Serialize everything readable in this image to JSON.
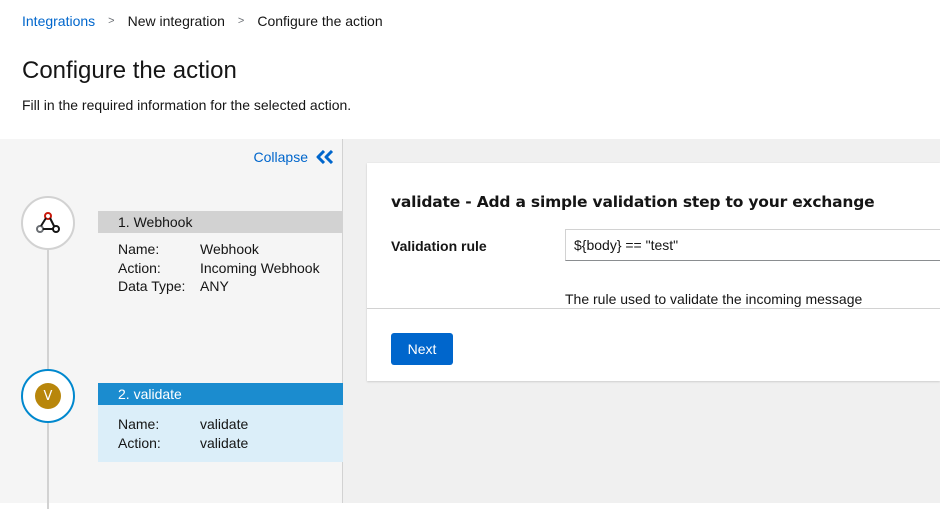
{
  "breadcrumb": {
    "items": [
      "Integrations",
      "New integration",
      "Configure the action"
    ],
    "separator": ">"
  },
  "page": {
    "title": "Configure the action",
    "description": "Fill in the required information for the selected action."
  },
  "sidebar": {
    "collapse_label": "Collapse",
    "collapse_icon": "double-chevron-left-icon",
    "steps": [
      {
        "title": "1. Webhook",
        "icon": "webhook-icon",
        "fields": [
          {
            "key": "Name:",
            "value": "Webhook"
          },
          {
            "key": "Action:",
            "value": "Incoming Webhook"
          },
          {
            "key": "Data Type:",
            "value": "ANY"
          }
        ]
      },
      {
        "title": "2. validate",
        "icon": "validate-icon",
        "icon_text": "V",
        "fields": [
          {
            "key": "Name:",
            "value": "validate"
          },
          {
            "key": "Action:",
            "value": "validate"
          }
        ]
      }
    ]
  },
  "form": {
    "title": "validate - Add a simple validation step to your exchange",
    "field_label": "Validation rule",
    "field_value": "${body} == \"test\"",
    "field_help": "The rule used to validate the incoming message",
    "next_label": "Next"
  },
  "colors": {
    "link": "#0066cc",
    "active_step": "#1b8ccf",
    "active_step_bg": "#dbeef9",
    "validate_icon": "#b8860b"
  }
}
